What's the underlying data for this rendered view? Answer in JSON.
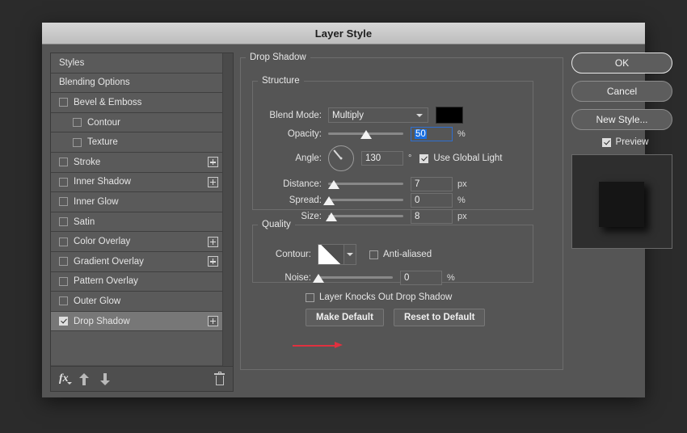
{
  "window": {
    "title": "Layer Style"
  },
  "sidebar": {
    "items": [
      {
        "label": "Styles",
        "type": "header",
        "checkbox": null,
        "indent": false,
        "plus": false,
        "selected": false
      },
      {
        "label": "Blending Options",
        "type": "header",
        "checkbox": null,
        "indent": false,
        "plus": false,
        "selected": false
      },
      {
        "label": "Bevel & Emboss",
        "type": "effect",
        "checkbox": false,
        "indent": false,
        "plus": false,
        "selected": false
      },
      {
        "label": "Contour",
        "type": "effect",
        "checkbox": false,
        "indent": true,
        "plus": false,
        "selected": false
      },
      {
        "label": "Texture",
        "type": "effect",
        "checkbox": false,
        "indent": true,
        "plus": false,
        "selected": false
      },
      {
        "label": "Stroke",
        "type": "effect",
        "checkbox": false,
        "indent": false,
        "plus": true,
        "selected": false
      },
      {
        "label": "Inner Shadow",
        "type": "effect",
        "checkbox": false,
        "indent": false,
        "plus": true,
        "selected": false
      },
      {
        "label": "Inner Glow",
        "type": "effect",
        "checkbox": false,
        "indent": false,
        "plus": false,
        "selected": false
      },
      {
        "label": "Satin",
        "type": "effect",
        "checkbox": false,
        "indent": false,
        "plus": false,
        "selected": false
      },
      {
        "label": "Color Overlay",
        "type": "effect",
        "checkbox": false,
        "indent": false,
        "plus": true,
        "selected": false
      },
      {
        "label": "Gradient Overlay",
        "type": "effect",
        "checkbox": false,
        "indent": false,
        "plus": true,
        "selected": false
      },
      {
        "label": "Pattern Overlay",
        "type": "effect",
        "checkbox": false,
        "indent": false,
        "plus": false,
        "selected": false
      },
      {
        "label": "Outer Glow",
        "type": "effect",
        "checkbox": false,
        "indent": false,
        "plus": false,
        "selected": false
      },
      {
        "label": "Drop Shadow",
        "type": "effect",
        "checkbox": true,
        "indent": false,
        "plus": true,
        "selected": true
      }
    ],
    "toolbar": {
      "fx_label": "fx",
      "move_up_label": "Move Up",
      "move_down_label": "Move Down",
      "delete_label": "Delete Effect"
    }
  },
  "main": {
    "group_title": "Drop Shadow",
    "structure": {
      "title": "Structure",
      "blend_mode_label": "Blend Mode:",
      "blend_mode_value": "Multiply",
      "shadow_color": "#000000",
      "opacity_label": "Opacity:",
      "opacity_value": "50",
      "opacity_unit": "%",
      "angle_label": "Angle:",
      "angle_value": "130",
      "angle_unit": "°",
      "use_global_light_label": "Use Global Light",
      "use_global_light_checked": true,
      "distance_label": "Distance:",
      "distance_value": "7",
      "distance_unit": "px",
      "spread_label": "Spread:",
      "spread_value": "0",
      "spread_unit": "%",
      "size_label": "Size:",
      "size_value": "8",
      "size_unit": "px"
    },
    "quality": {
      "title": "Quality",
      "contour_label": "Contour:",
      "anti_aliased_label": "Anti-aliased",
      "anti_aliased_checked": false,
      "noise_label": "Noise:",
      "noise_value": "0",
      "noise_unit": "%"
    },
    "knockout_label": "Layer Knocks Out Drop Shadow",
    "knockout_checked": false,
    "make_default_label": "Make Default",
    "reset_default_label": "Reset to Default",
    "annotation_color": "#e0313f"
  },
  "right": {
    "ok_label": "OK",
    "cancel_label": "Cancel",
    "new_style_label": "New Style...",
    "preview_label": "Preview",
    "preview_checked": true
  }
}
